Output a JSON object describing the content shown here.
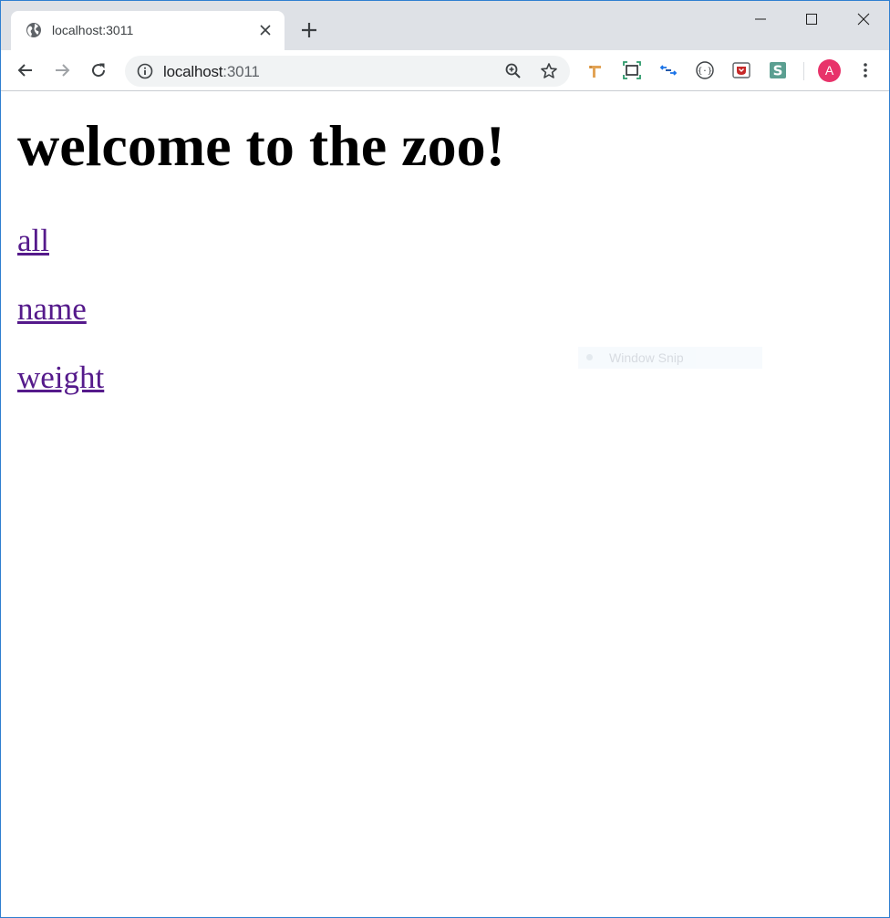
{
  "browser": {
    "tab": {
      "title": "localhost:3011"
    },
    "address_bar": {
      "host": "localhost",
      "port": ":3011"
    },
    "profile": {
      "initial": "A",
      "color": "#e8336a"
    }
  },
  "page": {
    "heading": "welcome to the zoo!",
    "links": [
      {
        "label": "all"
      },
      {
        "label": "name"
      },
      {
        "label": "weight"
      }
    ],
    "link_color": "#551a8b"
  },
  "overlay": {
    "label": "Window Snip"
  },
  "icons": {
    "tab_favicon": "globe-icon",
    "tab_close": "close-icon",
    "new_tab": "plus-icon",
    "back": "arrow-left-icon",
    "forward": "arrow-right-icon",
    "reload": "reload-icon",
    "site_info": "info-icon",
    "zoom": "zoom-in-icon",
    "bookmark": "star-icon",
    "extensions": [
      "pipe-extension-icon",
      "screenshot-extension-icon",
      "arrows-extension-icon",
      "code-extension-icon",
      "pocket-extension-icon",
      "s-extension-icon"
    ],
    "menu": "kebab-menu-icon"
  }
}
